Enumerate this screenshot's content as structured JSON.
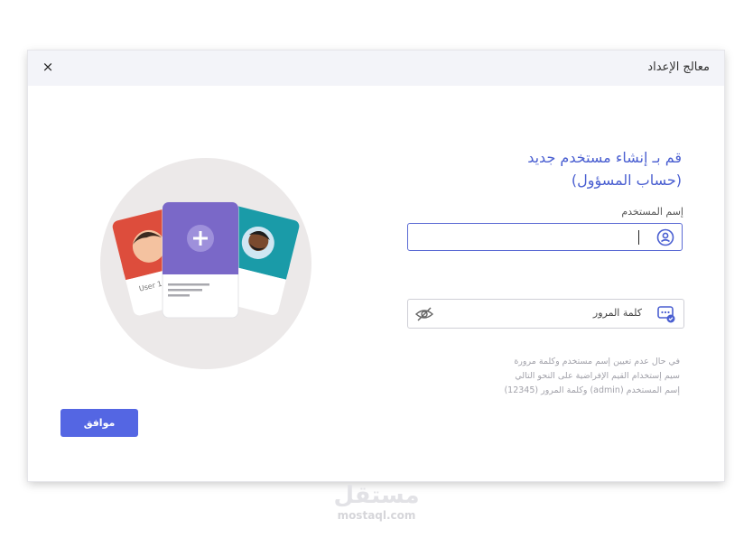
{
  "dialog": {
    "title": "معالج الإعداد",
    "close_label": "×"
  },
  "form": {
    "heading_line1": "قم بـ إنشاء مستخدم جديد",
    "heading_line2": "(حساب المسؤول)",
    "username_label": "إسم المستخدم",
    "username_value": "",
    "password_placeholder": "كلمة المرور",
    "hint_line1": "في حال عدم تعيين إسم مستخدم وكلمة مرورة",
    "hint_line2": "سيم إستخدام القيم الإفراضية على النحو التالي",
    "hint_line3": "إسم المستخدم (admin) وكلمة المرور (12345)",
    "ok_label": "موافق"
  },
  "illustration": {
    "card_left_label": "User 1"
  },
  "watermark": {
    "arabic": "مستقل",
    "latin": "mostaql.com"
  },
  "colors": {
    "accent": "#5466e3",
    "heading": "#4a5fd1",
    "card_red": "#dd4d3c",
    "card_purple": "#7a68c8",
    "card_teal": "#1a9ba8",
    "circle_bg": "#ece9e9"
  },
  "icons": {
    "close": "close-icon",
    "user_field": "user-circle-icon",
    "password_field": "password-icon",
    "visibility": "eye-slash-icon",
    "add": "plus-icon"
  }
}
